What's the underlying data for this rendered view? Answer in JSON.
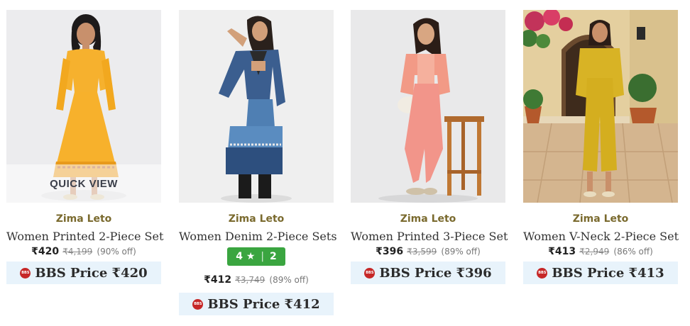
{
  "quick_view_label": "QUICK VIEW",
  "bbs_badge_text": "BBS",
  "products": [
    {
      "brand": "Zima Leto",
      "name": "Women Printed 2-Piece Set",
      "price": "₹420",
      "mrp": "₹4,199",
      "discount": "(90% off)",
      "bbs_price": "BBS Price ₹420",
      "outfit_color": "#f6b12e"
    },
    {
      "brand": "Zima Leto",
      "name": "Women Denim 2-Piece Sets",
      "rating_value": "4",
      "rating_star": "★",
      "rating_sep": "|",
      "rating_count": "2",
      "price": "₹412",
      "mrp": "₹3,749",
      "discount": "(89% off)",
      "bbs_price": "BBS Price ₹412",
      "outfit_color": "#3b5e8f"
    },
    {
      "brand": "Zima Leto",
      "name": "Women Printed 3-Piece Set",
      "price": "₹396",
      "mrp": "₹3,599",
      "discount": "(89% off)",
      "bbs_price": "BBS Price ₹396",
      "outfit_color": "#f29a86"
    },
    {
      "brand": "Zima Leto",
      "name": "Women V-Neck 2-Piece Set",
      "price": "₹413",
      "mrp": "₹2,949",
      "discount": "(86% off)",
      "bbs_price": "BBS Price ₹413",
      "outfit_color": "#d8b325"
    }
  ],
  "colors": {
    "brand_text": "#7a6a2e",
    "rating_bg": "#3aa540",
    "bbs_bg": "#e8f3fb",
    "bbs_badge": "#c62828"
  }
}
